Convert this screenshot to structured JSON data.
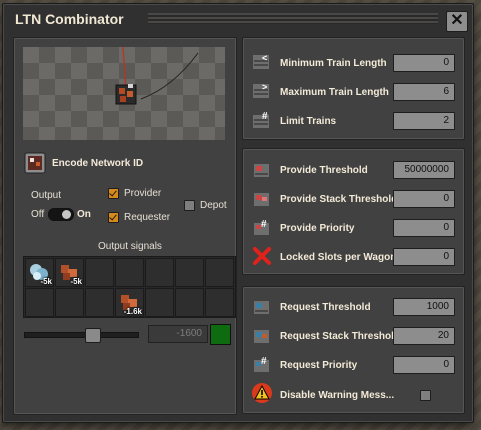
{
  "window": {
    "title": "LTN Combinator",
    "close_label": "✕"
  },
  "left": {
    "encode_label": "Encode Network ID",
    "output_label": "Output",
    "toggle_off": "Off",
    "toggle_on": "On",
    "provider_label": "Provider",
    "requester_label": "Requester",
    "depot_label": "Depot",
    "provider_checked": true,
    "requester_checked": true,
    "depot_checked": false,
    "signals_title": "Output signals",
    "slider_value": "-1600",
    "signals": [
      {
        "icon": "ice-icon",
        "count": "-5k"
      },
      {
        "icon": "copper-ore-icon",
        "count": "-5k"
      },
      {
        "icon": "",
        "count": ""
      },
      {
        "icon": "",
        "count": ""
      },
      {
        "icon": "",
        "count": ""
      },
      {
        "icon": "",
        "count": ""
      },
      {
        "icon": "",
        "count": ""
      },
      {
        "icon": "",
        "count": ""
      },
      {
        "icon": "",
        "count": ""
      },
      {
        "icon": "",
        "count": ""
      },
      {
        "icon": "copper-ore-icon",
        "count": "-1.6k"
      },
      {
        "icon": "",
        "count": ""
      },
      {
        "icon": "",
        "count": ""
      },
      {
        "icon": "",
        "count": ""
      }
    ]
  },
  "train": {
    "min_length_label": "Minimum Train Length",
    "min_length_value": "0",
    "max_length_label": "Maximum Train Length",
    "max_length_value": "6",
    "limit_label": "Limit Trains",
    "limit_value": "2"
  },
  "provide": {
    "threshold_label": "Provide Threshold",
    "threshold_value": "50000000",
    "stack_label": "Provide Stack Threshold",
    "stack_value": "0",
    "priority_label": "Provide Priority",
    "priority_value": "0",
    "locked_label": "Locked Slots per Wagon",
    "locked_value": "0"
  },
  "request": {
    "threshold_label": "Request Threshold",
    "threshold_value": "1000",
    "stack_label": "Request Stack Threshold",
    "stack_value": "20",
    "priority_label": "Request Priority",
    "priority_value": "0",
    "warning_label": "Disable Warning Mess...",
    "warning_checked": false
  },
  "colors": {
    "accent": "#d58a1d",
    "panel": "#414141",
    "window": "#313031"
  }
}
